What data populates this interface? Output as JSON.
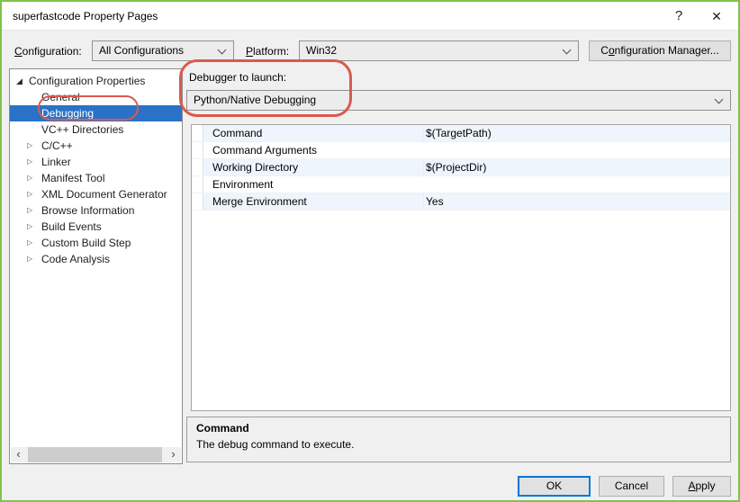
{
  "window": {
    "title": "superfastcode Property Pages"
  },
  "icons": {
    "help_icon": "?",
    "close_icon": "✕",
    "expander_expanded": "◢",
    "expander_collapsed": "▷",
    "scroll_left_icon": "‹",
    "scroll_right_icon": "›",
    "dropdown": "chevron-down"
  },
  "config_row": {
    "configuration_label": {
      "mn": "C",
      "rest": "onfiguration:"
    },
    "configuration_value": "All Configurations",
    "platform_label": {
      "mn": "P",
      "rest": "latform:"
    },
    "platform_value": "Win32",
    "manager_button": {
      "pre": "C",
      "mn": "o",
      "rest": "nfiguration Manager..."
    }
  },
  "sidebar": {
    "items": [
      {
        "label": "Configuration Properties",
        "level": 0,
        "state": "expanded",
        "selected": false
      },
      {
        "label": "General",
        "level": 1,
        "state": "leaf",
        "selected": false
      },
      {
        "label": "Debugging",
        "level": 1,
        "state": "leaf",
        "selected": true
      },
      {
        "label": "VC++ Directories",
        "level": 1,
        "state": "leaf",
        "selected": false
      },
      {
        "label": "C/C++",
        "level": 1,
        "state": "collapsed",
        "selected": false
      },
      {
        "label": "Linker",
        "level": 1,
        "state": "collapsed",
        "selected": false
      },
      {
        "label": "Manifest Tool",
        "level": 1,
        "state": "collapsed",
        "selected": false
      },
      {
        "label": "XML Document Generator",
        "level": 1,
        "state": "collapsed",
        "selected": false
      },
      {
        "label": "Browse Information",
        "level": 1,
        "state": "collapsed",
        "selected": false
      },
      {
        "label": "Build Events",
        "level": 1,
        "state": "collapsed",
        "selected": false
      },
      {
        "label": "Custom Build Step",
        "level": 1,
        "state": "collapsed",
        "selected": false
      },
      {
        "label": "Code Analysis",
        "level": 1,
        "state": "collapsed",
        "selected": false
      }
    ]
  },
  "debugger_section": {
    "label": "Debugger to launch:",
    "value": "Python/Native Debugging"
  },
  "grid": {
    "rows": [
      {
        "name": "Command",
        "value": "$(TargetPath)"
      },
      {
        "name": "Command Arguments",
        "value": ""
      },
      {
        "name": "Working Directory",
        "value": "$(ProjectDir)"
      },
      {
        "name": "Environment",
        "value": ""
      },
      {
        "name": "Merge Environment",
        "value": "Yes"
      }
    ]
  },
  "description": {
    "title": "Command",
    "text": "The debug command to execute."
  },
  "footer": {
    "ok": "OK",
    "cancel": "Cancel",
    "apply": {
      "mn": "A",
      "rest": "pply"
    }
  },
  "colors": {
    "annotation": "#d95a4f",
    "selection": "#2a72c8",
    "window_border": "#7ec24c",
    "ok_focus": "#0078d7"
  }
}
